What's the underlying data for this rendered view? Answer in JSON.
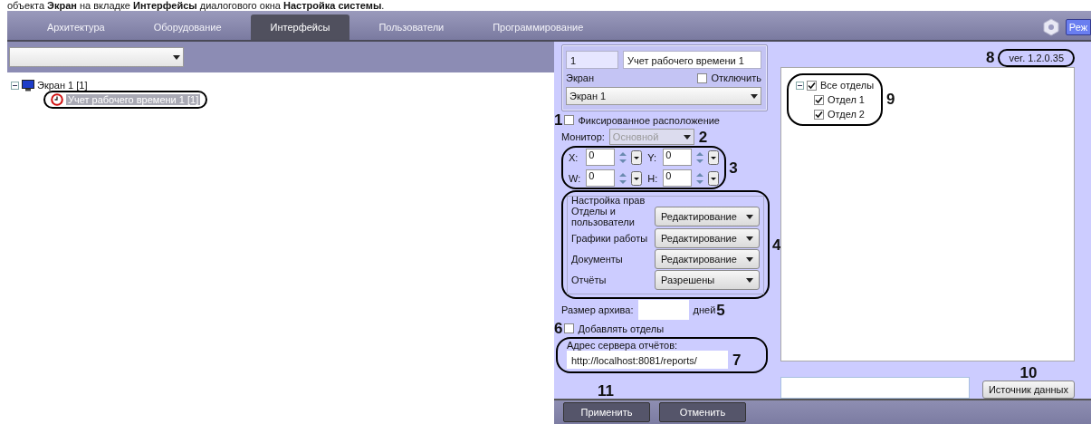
{
  "caption": "объекта **Экран** на вкладке **Интерфейсы** диалогового окна **Настройка системы**.",
  "tabs": [
    {
      "label": "Архитектура",
      "selected": false
    },
    {
      "label": "Оборудование",
      "selected": false
    },
    {
      "label": "Интерфейсы",
      "selected": true
    },
    {
      "label": "Пользователи",
      "selected": false
    },
    {
      "label": "Программирование",
      "selected": false
    }
  ],
  "mode_button": "Реж",
  "tree": [
    {
      "label": "Экран 1 [1]",
      "kind": "screen",
      "expanded": true,
      "selected": false,
      "children": [
        {
          "label": "Учет рабочего времени 1 [1]",
          "kind": "clock",
          "selected": true
        }
      ]
    }
  ],
  "panel": {
    "id": "1",
    "name": "Учет рабочего времени 1",
    "screen_label": "Экран",
    "disable": {
      "label": "Отключить",
      "checked": false
    },
    "screen_value": "Экран 1",
    "fixed": {
      "label": "Фиксированное расположение",
      "checked": false
    },
    "monitor": {
      "label": "Монитор:",
      "value": "Основной",
      "disabled": true
    },
    "coords": [
      {
        "label": "X:",
        "value": "0"
      },
      {
        "label": "Y:",
        "value": "0"
      },
      {
        "label": "W:",
        "value": "0"
      },
      {
        "label": "H:",
        "value": "0"
      }
    ],
    "rights": {
      "title": "Настройка прав",
      "rows": [
        {
          "label": "Отделы и пользователи",
          "value": "Редактирование"
        },
        {
          "label": "Графики работы",
          "value": "Редактирование"
        },
        {
          "label": "Документы",
          "value": "Редактирование"
        },
        {
          "label": "Отчёты",
          "value": "Разрешены"
        }
      ]
    },
    "archive": {
      "label": "Размер архива:",
      "unit": "дней"
    },
    "add_departments": {
      "label": "Добавлять отделы",
      "checked": false
    },
    "server": {
      "label": "Адрес сервера отчётов:",
      "value": "http://localhost:8081/reports/"
    },
    "version": "ver. 1.2.0.35",
    "departments": [
      {
        "label": "Все отделы",
        "checked": true,
        "expanded": true,
        "children": [
          {
            "label": "Отдел 1",
            "checked": true
          },
          {
            "label": "Отдел 2",
            "checked": true
          }
        ]
      }
    ],
    "datasource_button": "Источник данных"
  },
  "buttons": [
    "Применить",
    "Отменить"
  ],
  "callouts": [
    "1",
    "2",
    "3",
    "4",
    "5",
    "6",
    "7",
    "8",
    "9",
    "10",
    "11"
  ]
}
